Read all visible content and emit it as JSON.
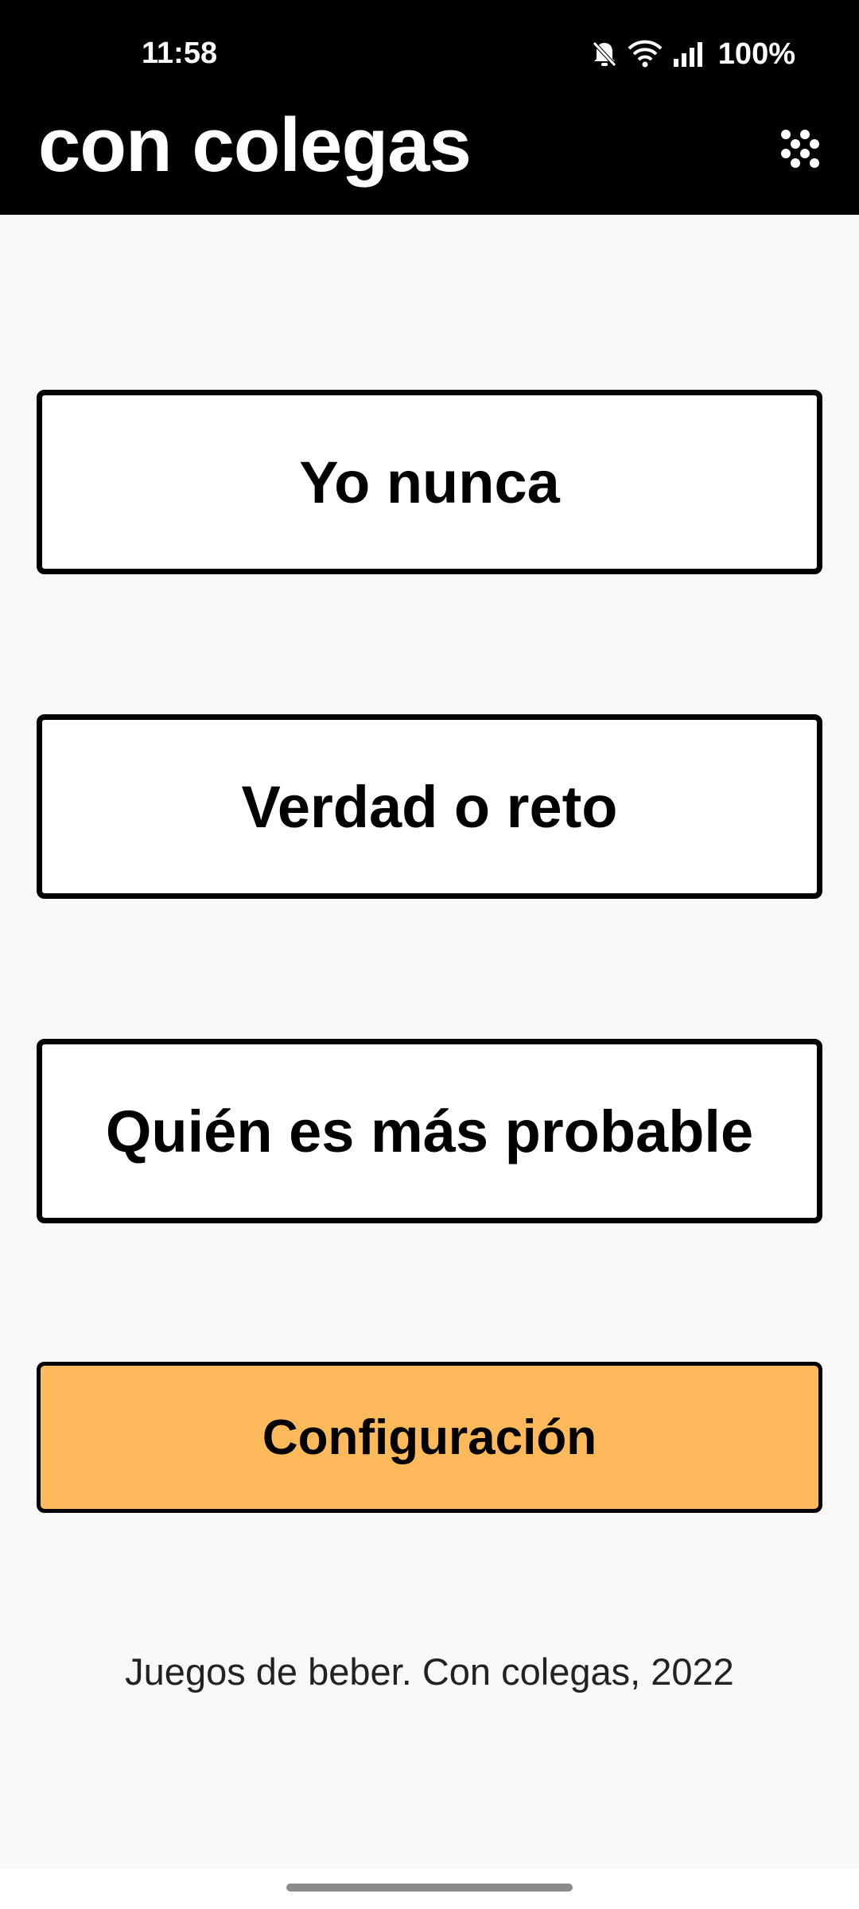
{
  "status_bar": {
    "time": "11:58",
    "battery": "100%",
    "icons": [
      "bell-off-icon",
      "wifi-icon",
      "signal-icon"
    ]
  },
  "app_bar": {
    "title": "con colegas",
    "menu_icon": "dots-menu-icon"
  },
  "games": [
    {
      "label": "Yo nunca"
    },
    {
      "label": "Verdad o reto"
    },
    {
      "label": "Quién es más probable"
    }
  ],
  "settings": {
    "label": "Configuración",
    "color": "#fdb95a"
  },
  "footer": {
    "text": "Juegos de beber. Con colegas, 2022"
  },
  "colors": {
    "header": "#000000",
    "background": "#f9f9f9",
    "accent": "#fdb95a"
  }
}
